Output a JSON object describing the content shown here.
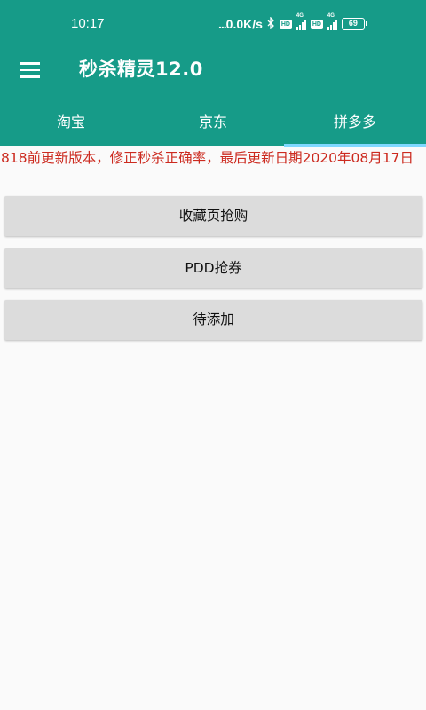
{
  "status_bar": {
    "time": "10:17",
    "net_speed": "0.0K/s",
    "net_speed_dots": "...",
    "hd1": "HD",
    "hd2": "HD",
    "sig1_label": "4G",
    "sig2_label": "4G",
    "battery": "69"
  },
  "toolbar": {
    "title": "秒杀精灵12.0"
  },
  "tabs": [
    {
      "label": "淘宝"
    },
    {
      "label": "京东"
    },
    {
      "label": "拼多多"
    }
  ],
  "active_tab": "拼多多",
  "notice": "818前更新版本，修正秒杀正确率，最后更新日期2020年08月17日",
  "buttons": [
    {
      "label": "收藏页抢购"
    },
    {
      "label": "PDD抢券"
    },
    {
      "label": "待添加"
    }
  ],
  "colors": {
    "primary": "#169b88",
    "tab_indicator": "#7fd8ff",
    "notice_text": "#cc2a1f",
    "button_bg": "#dcdcdc",
    "page_bg": "#fafafa"
  }
}
